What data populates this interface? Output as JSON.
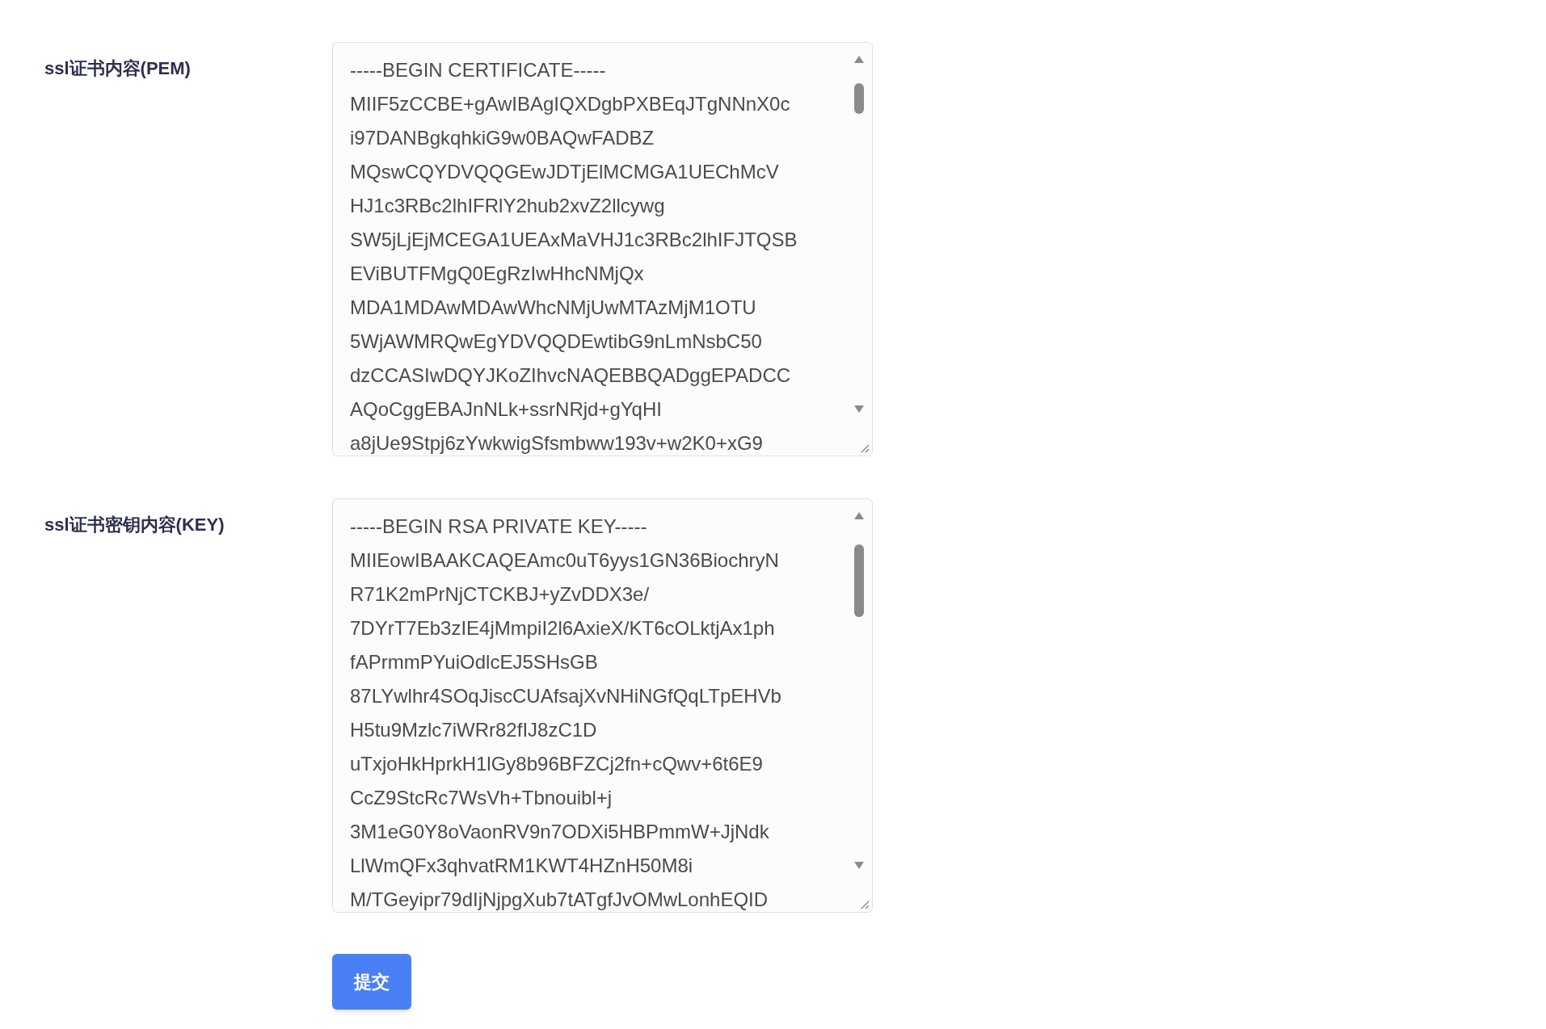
{
  "fields": [
    {
      "label": "ssl证书内容(PEM)",
      "lines": [
        "-----BEGIN CERTIFICATE-----",
        "MIIF5zCCBE+gAwIBAgIQXDgbPXBEqJTgNNnX0c",
        "i97DANBgkqhkiG9w0BAQwFADBZ",
        "MQswCQYDVQQGEwJDTjElMCMGA1UEChMcV",
        "HJ1c3RBc2lhIFRlY2hub2xvZ2llcywg",
        "SW5jLjEjMCEGA1UEAxMaVHJ1c3RBc2lhIFJTQSB",
        "EViBUTFMgQ0EgRzIwHhcNMjQx",
        "MDA1MDAwMDAwWhcNMjUwMTAzMjM1OTU",
        "5WjAWMRQwEgYDVQQDEwtibG9nLmNsbC50",
        "dzCCASIwDQYJKoZIhvcNAQEBBQADggEPADCC",
        "AQoCggEBAJnNLk+ssrNRjd+gYqHI",
        "a8jUe9Stpj6zYwkwigSfsmbww193v+w2K0+xG9"
      ]
    },
    {
      "label": "ssl证书密钥内容(KEY)",
      "lines": [
        "-----BEGIN RSA PRIVATE KEY-----",
        "MIIEowIBAAKCAQEAmc0uT6yys1GN36BiochryN",
        "R71K2mPrNjCTCKBJ+yZvDDX3e/",
        "7DYrT7Eb3zIE4jMmpiI2l6AxieX/KT6cOLktjAx1ph",
        "fAPrmmPYuiOdlcEJ5SHsGB",
        "87LYwlhr4SOqJiscCUAfsajXvNHiNGfQqLTpEHVb",
        "H5tu9Mzlc7iWRr82fIJ8zC1D",
        "uTxjoHkHprkH1lGy8b96BFZCj2fn+cQwv+6t6E9",
        "CcZ9StcRc7WsVh+Tbnouibl+j",
        "3M1eG0Y8oVaonRV9n7ODXi5HBPmmW+JjNdk",
        "LlWmQFx3qhvatRM1KWT4HZnH50M8i",
        "M/TGeyipr79dIjNjpgXub7tATgfJvOMwLonhEQID"
      ]
    }
  ],
  "submit": "提交"
}
